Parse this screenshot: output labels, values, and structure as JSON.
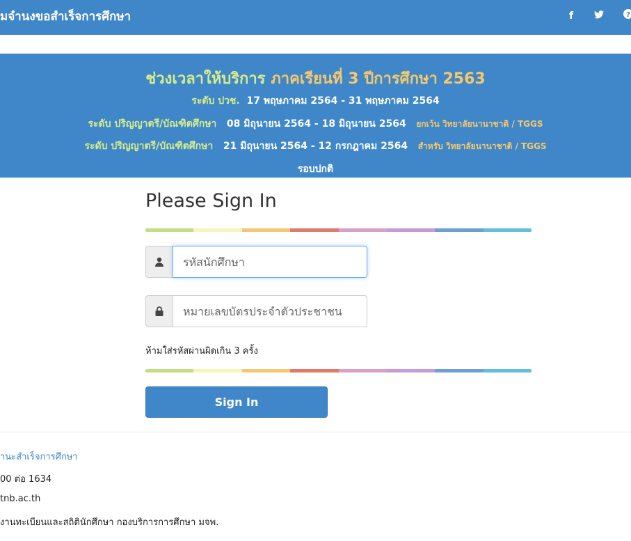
{
  "navbar": {
    "brand": "มจำนงขอสำเร็จการศึกษา",
    "icons": [
      "facebook-icon",
      "twitter-icon",
      "help-icon"
    ]
  },
  "banner": {
    "title_prefix": "ช่วงเวลาให้บริการ",
    "title_suffix": "ภาคเรียนที่  3  ปีการศึกษา  2563",
    "line1_label": "ระดับ ปวช.",
    "line1_dates": "17 พฤษภาคม 2564 - 31 พฤษภาคม 2564",
    "line2_label": "ระดับ ปริญญาตรี/บัณฑิตศึกษา",
    "line2_dates": "08 มิถุนายน 2564 - 18 มิถุนายน 2564",
    "line2_note": "ยกเว้น วิทยาลัยนานาชาติ / TGGS",
    "line3_label": "ระดับ ปริญญาตรี/บัณฑิตศึกษา",
    "line3_dates": "21 มิถุนายน 2564 - 12 กรกฎาคม 2564",
    "line3_note": "สำหรับ วิทยาลัยนานาชาติ / TGGS",
    "round": "รอบปกติ"
  },
  "form": {
    "heading": "Please Sign In",
    "student_id_placeholder": "รหัสนักศึกษา",
    "student_id_value": "",
    "id_card_placeholder": "หมายเลขบัตรประจำตัวประชาชน",
    "id_card_value": "",
    "warning": "ห้ามใส่รหัสผ่านผิดเกิน 3 ครั้ง",
    "submit_label": "Sign In"
  },
  "rainbow_colors": [
    "#c5dd84",
    "#f7f4bd",
    "#f4c873",
    "#e07a6a",
    "#d8a1c9",
    "#c99bd6",
    "#6d9fd2",
    "#63bddc"
  ],
  "footer": {
    "line1": "านะสำเร็จการศึกษา",
    "line2": "00 ต่อ 1634",
    "line3": "tnb.ac.th",
    "line4": "งานทะเบียนและสถิตินักศึกษา กองบริการการศึกษา มจพ."
  }
}
